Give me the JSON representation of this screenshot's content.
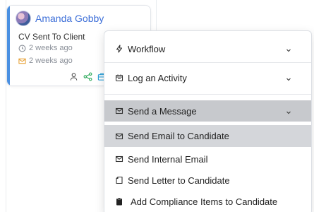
{
  "card": {
    "candidate_name": "Amanda Gobby",
    "status": "CV Sent To Client",
    "meta_time_1": "2 weeks ago",
    "meta_time_2": "2 weeks ago",
    "accent_color": "#4a90e2"
  },
  "menu": {
    "workflow": "Workflow",
    "log_activity": "Log an Activity",
    "send_message": "Send a Message",
    "send_email": "Send Email to Candidate",
    "send_internal": "Send Internal Email",
    "send_letter": "Send Letter to Candidate",
    "add_compliance": "Add Compliance Items to Candidate"
  },
  "colors": {
    "name_link": "#3d6fd8",
    "highlight_section": "#c7c9cd",
    "highlight_item": "#d4d6da"
  }
}
